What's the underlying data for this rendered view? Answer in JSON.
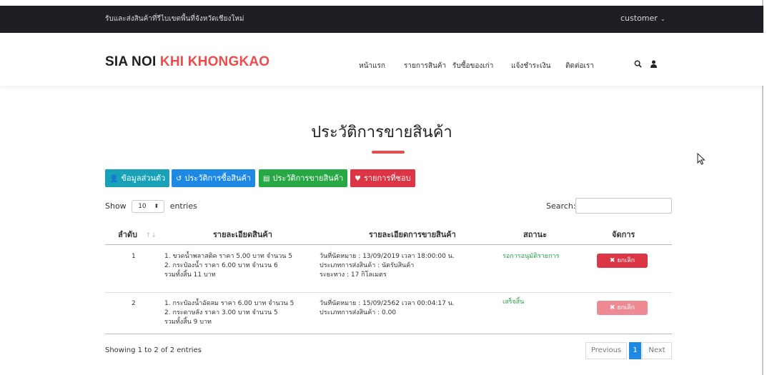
{
  "topbar": {
    "notice": "รับและส่งสินค้าที่รีไบเขตพื้นที่จังหวัดเชียงใหม่",
    "user": "customer",
    "user_caret": "⌄"
  },
  "brand": {
    "part1": "SIA NOI",
    "part2": "KHI KHONGKAO"
  },
  "nav": {
    "items": [
      "หน้าแรก",
      "รายการสินค้า",
      "รับซื้อของเก่า",
      "แจ้งชำระเงิน",
      "ติดต่อเรา"
    ],
    "icons": [
      "search-icon",
      "user-icon"
    ]
  },
  "page": {
    "title": "ประวัติการขายสินค้า"
  },
  "tabs": [
    {
      "icon": "user-icon",
      "glyph": "👤",
      "label": "ข้อมูลส่วนตัว",
      "color": "#17a2b8"
    },
    {
      "icon": "history-icon",
      "glyph": "↺",
      "label": "ประวัติการซื้อสินค้า",
      "color": "#1e88e5"
    },
    {
      "icon": "list-icon",
      "glyph": "▤",
      "label": "ประวัติการขายสินค้า",
      "color": "#28a745"
    },
    {
      "icon": "heart-icon",
      "glyph": "♥",
      "label": "รายการที่ชอบ",
      "color": "#dc3545"
    }
  ],
  "table_controls": {
    "show_label": "Show",
    "entries_value": "10",
    "entries_label": "entries",
    "search_label": "Search:",
    "search_value": ""
  },
  "table": {
    "headers": [
      "ลำดับ",
      "รายละเอียดสินค้า",
      "รายละเอียดการขายสินค้า",
      "สถานะ",
      "จัดการ"
    ],
    "sort_icon": "↑↓",
    "rows": [
      {
        "no": "1",
        "items": [
          "1. ขวดน้ำพลาสติค ราคา 5.00 บาท จำนวน 5",
          "2. กระป๋องน้ำ ราคา 6.00 บาท จำนวน 6",
          "รวมทั้งสิ้น 11 บาท"
        ],
        "details": [
          "วันที่นัดหมาย : 13/09/2019 เวลา 18:00:00 น.",
          "ประเภทการส่งสินค้า : นัดรับสินค้า",
          "ระยะทาง : 17 กิโลเมตร"
        ],
        "status": "รอการอนุมัติรายการ",
        "action": "ยกเลิก",
        "action_enabled": true
      },
      {
        "no": "2",
        "items": [
          "1. กระป๋องน้ำอัดลม ราคา 6.00 บาท จำนวน 5",
          "2. กระดาษลัง ราคา 3.00 บาท จำนวน 5",
          "รวมทั้งสิ้น 9 บาท"
        ],
        "details": [
          "วันที่นัดหมาย : 15/09/2562 เวลา 00:04:17 น.",
          "ประเภทการส่งสินค้า : 0.00",
          ""
        ],
        "status": "เสร็จสิ้น",
        "action": "ยกเลิก",
        "action_enabled": false
      }
    ]
  },
  "footer": {
    "showing": "Showing 1 to 2 of 2 entries",
    "previous": "Previous",
    "current_page": "1",
    "next": "Next"
  },
  "colors": {
    "accent_red": "#ef4b4b",
    "topbar_bg": "#1e1e24",
    "info": "#17a2b8",
    "primary": "#1e88e5",
    "success": "#28a745",
    "danger": "#dc3545"
  }
}
